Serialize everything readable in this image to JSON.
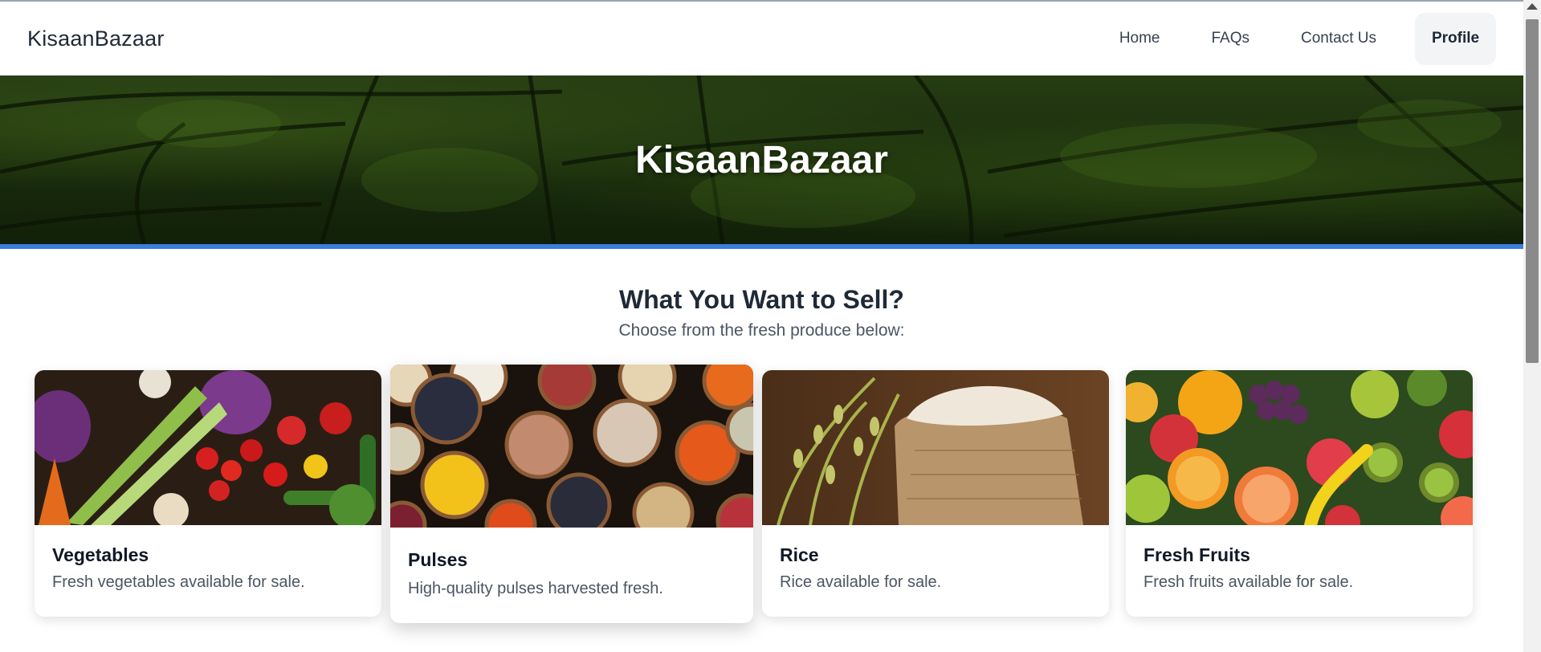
{
  "navbar": {
    "brand": "KisaanBazaar",
    "links": [
      {
        "label": "Home"
      },
      {
        "label": "FAQs"
      },
      {
        "label": "Contact Us"
      }
    ],
    "profile_label": "Profile"
  },
  "hero": {
    "title": "KisaanBazaar"
  },
  "section": {
    "heading": "What You Want to Sell?",
    "subheading": "Choose from the fresh produce below:"
  },
  "cards": [
    {
      "title": "Vegetables",
      "description": "Fresh vegetables available for sale."
    },
    {
      "title": "Pulses",
      "description": "High-quality pulses harvested fresh."
    },
    {
      "title": "Rice",
      "description": "Rice available for sale."
    },
    {
      "title": "Fresh Fruits",
      "description": "Fresh fruits available for sale."
    }
  ],
  "colors": {
    "accent_bar": "#3b7ddd",
    "profile_bg": "#f3f4f6",
    "hero_green": "#2f4a18"
  }
}
